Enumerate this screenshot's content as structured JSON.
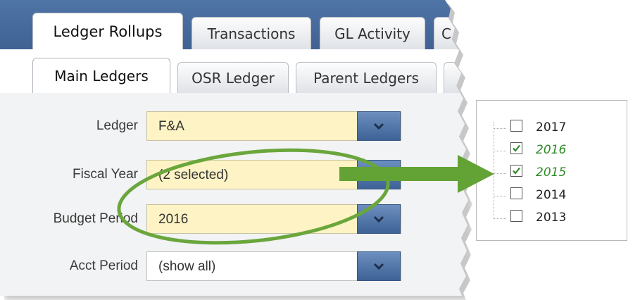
{
  "tabs": {
    "primary": [
      {
        "label": "Ledger Rollups",
        "active": true
      },
      {
        "label": "Transactions",
        "active": false
      },
      {
        "label": "GL Activity",
        "active": false
      },
      {
        "label": "C",
        "active": false
      }
    ],
    "secondary": [
      {
        "label": "Main Ledgers",
        "active": true
      },
      {
        "label": "OSR Ledger",
        "active": false
      },
      {
        "label": "Parent Ledgers",
        "active": false
      }
    ]
  },
  "form": {
    "ledger": {
      "label": "Ledger",
      "value": "F&A"
    },
    "fiscal_year": {
      "label": "Fiscal Year",
      "value": "(2 selected)"
    },
    "budget_period": {
      "label": "Budget Period",
      "value": "2016"
    },
    "acct_period": {
      "label": "Acct Period",
      "value": "(show all)"
    }
  },
  "year_options": [
    {
      "year": "2017",
      "checked": false
    },
    {
      "year": "2016",
      "checked": true
    },
    {
      "year": "2015",
      "checked": true
    },
    {
      "year": "2014",
      "checked": false
    },
    {
      "year": "2013",
      "checked": false
    }
  ],
  "colors": {
    "tab_band": "#4a6fa2",
    "field_highlight": "#fdf3c4",
    "dropdown_button": "#4d71a6",
    "annotation_green": "#67a83b",
    "selected_text": "#2e8a28"
  }
}
